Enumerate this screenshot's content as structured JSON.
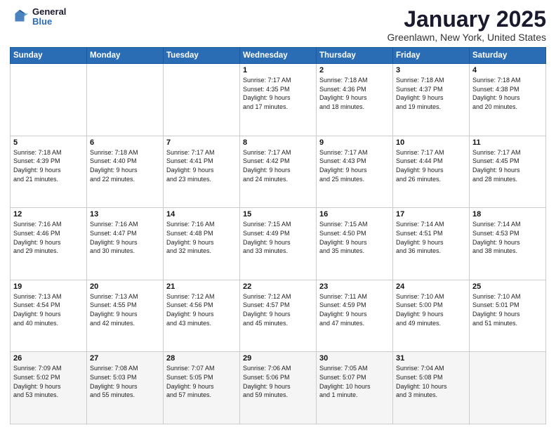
{
  "header": {
    "logo_general": "General",
    "logo_blue": "Blue",
    "title": "January 2025",
    "location": "Greenlawn, New York, United States"
  },
  "weekdays": [
    "Sunday",
    "Monday",
    "Tuesday",
    "Wednesday",
    "Thursday",
    "Friday",
    "Saturday"
  ],
  "weeks": [
    [
      {
        "day": "",
        "info": ""
      },
      {
        "day": "",
        "info": ""
      },
      {
        "day": "",
        "info": ""
      },
      {
        "day": "1",
        "info": "Sunrise: 7:17 AM\nSunset: 4:35 PM\nDaylight: 9 hours\nand 17 minutes."
      },
      {
        "day": "2",
        "info": "Sunrise: 7:18 AM\nSunset: 4:36 PM\nDaylight: 9 hours\nand 18 minutes."
      },
      {
        "day": "3",
        "info": "Sunrise: 7:18 AM\nSunset: 4:37 PM\nDaylight: 9 hours\nand 19 minutes."
      },
      {
        "day": "4",
        "info": "Sunrise: 7:18 AM\nSunset: 4:38 PM\nDaylight: 9 hours\nand 20 minutes."
      }
    ],
    [
      {
        "day": "5",
        "info": "Sunrise: 7:18 AM\nSunset: 4:39 PM\nDaylight: 9 hours\nand 21 minutes."
      },
      {
        "day": "6",
        "info": "Sunrise: 7:18 AM\nSunset: 4:40 PM\nDaylight: 9 hours\nand 22 minutes."
      },
      {
        "day": "7",
        "info": "Sunrise: 7:17 AM\nSunset: 4:41 PM\nDaylight: 9 hours\nand 23 minutes."
      },
      {
        "day": "8",
        "info": "Sunrise: 7:17 AM\nSunset: 4:42 PM\nDaylight: 9 hours\nand 24 minutes."
      },
      {
        "day": "9",
        "info": "Sunrise: 7:17 AM\nSunset: 4:43 PM\nDaylight: 9 hours\nand 25 minutes."
      },
      {
        "day": "10",
        "info": "Sunrise: 7:17 AM\nSunset: 4:44 PM\nDaylight: 9 hours\nand 26 minutes."
      },
      {
        "day": "11",
        "info": "Sunrise: 7:17 AM\nSunset: 4:45 PM\nDaylight: 9 hours\nand 28 minutes."
      }
    ],
    [
      {
        "day": "12",
        "info": "Sunrise: 7:16 AM\nSunset: 4:46 PM\nDaylight: 9 hours\nand 29 minutes."
      },
      {
        "day": "13",
        "info": "Sunrise: 7:16 AM\nSunset: 4:47 PM\nDaylight: 9 hours\nand 30 minutes."
      },
      {
        "day": "14",
        "info": "Sunrise: 7:16 AM\nSunset: 4:48 PM\nDaylight: 9 hours\nand 32 minutes."
      },
      {
        "day": "15",
        "info": "Sunrise: 7:15 AM\nSunset: 4:49 PM\nDaylight: 9 hours\nand 33 minutes."
      },
      {
        "day": "16",
        "info": "Sunrise: 7:15 AM\nSunset: 4:50 PM\nDaylight: 9 hours\nand 35 minutes."
      },
      {
        "day": "17",
        "info": "Sunrise: 7:14 AM\nSunset: 4:51 PM\nDaylight: 9 hours\nand 36 minutes."
      },
      {
        "day": "18",
        "info": "Sunrise: 7:14 AM\nSunset: 4:53 PM\nDaylight: 9 hours\nand 38 minutes."
      }
    ],
    [
      {
        "day": "19",
        "info": "Sunrise: 7:13 AM\nSunset: 4:54 PM\nDaylight: 9 hours\nand 40 minutes."
      },
      {
        "day": "20",
        "info": "Sunrise: 7:13 AM\nSunset: 4:55 PM\nDaylight: 9 hours\nand 42 minutes."
      },
      {
        "day": "21",
        "info": "Sunrise: 7:12 AM\nSunset: 4:56 PM\nDaylight: 9 hours\nand 43 minutes."
      },
      {
        "day": "22",
        "info": "Sunrise: 7:12 AM\nSunset: 4:57 PM\nDaylight: 9 hours\nand 45 minutes."
      },
      {
        "day": "23",
        "info": "Sunrise: 7:11 AM\nSunset: 4:59 PM\nDaylight: 9 hours\nand 47 minutes."
      },
      {
        "day": "24",
        "info": "Sunrise: 7:10 AM\nSunset: 5:00 PM\nDaylight: 9 hours\nand 49 minutes."
      },
      {
        "day": "25",
        "info": "Sunrise: 7:10 AM\nSunset: 5:01 PM\nDaylight: 9 hours\nand 51 minutes."
      }
    ],
    [
      {
        "day": "26",
        "info": "Sunrise: 7:09 AM\nSunset: 5:02 PM\nDaylight: 9 hours\nand 53 minutes."
      },
      {
        "day": "27",
        "info": "Sunrise: 7:08 AM\nSunset: 5:03 PM\nDaylight: 9 hours\nand 55 minutes."
      },
      {
        "day": "28",
        "info": "Sunrise: 7:07 AM\nSunset: 5:05 PM\nDaylight: 9 hours\nand 57 minutes."
      },
      {
        "day": "29",
        "info": "Sunrise: 7:06 AM\nSunset: 5:06 PM\nDaylight: 9 hours\nand 59 minutes."
      },
      {
        "day": "30",
        "info": "Sunrise: 7:05 AM\nSunset: 5:07 PM\nDaylight: 10 hours\nand 1 minute."
      },
      {
        "day": "31",
        "info": "Sunrise: 7:04 AM\nSunset: 5:08 PM\nDaylight: 10 hours\nand 3 minutes."
      },
      {
        "day": "",
        "info": ""
      }
    ]
  ]
}
